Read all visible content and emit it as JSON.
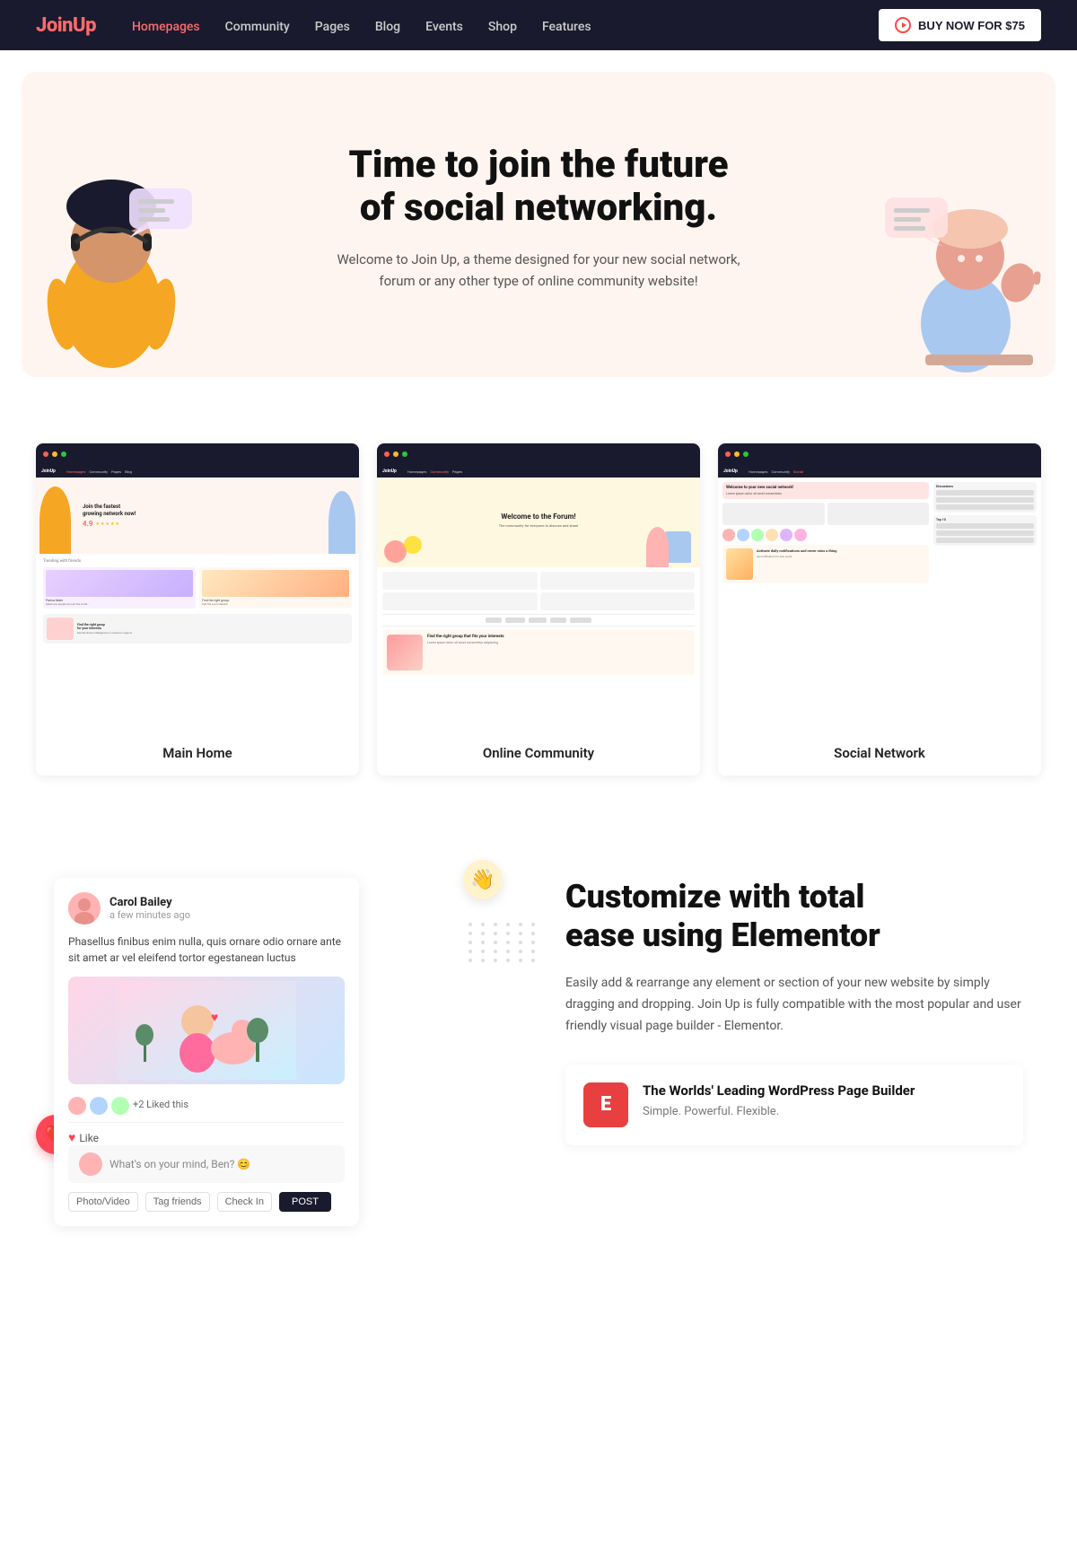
{
  "navbar": {
    "logo": "Join",
    "logo_accent": "Up",
    "nav_items": [
      {
        "label": "Homepages",
        "active": true
      },
      {
        "label": "Community",
        "active": false
      },
      {
        "label": "Pages",
        "active": false
      },
      {
        "label": "Blog",
        "active": false
      },
      {
        "label": "Events",
        "active": false
      },
      {
        "label": "Shop",
        "active": false
      },
      {
        "label": "Features",
        "active": false
      }
    ],
    "buy_button": "BUY NOW FOR $75"
  },
  "hero": {
    "heading_line1": "Time to join the future",
    "heading_line2": "of social networking.",
    "subtext": "Welcome to Join Up, a theme designed for your new social network, forum or any other type of online community website!"
  },
  "previews": [
    {
      "label": "Main Home",
      "title": "Join the fastest growing network now!",
      "stat": "4.9"
    },
    {
      "label": "Online Community",
      "title": "Welcome to the Forum!"
    },
    {
      "label": "Social Network",
      "title": "Welcome to your new social network!"
    }
  ],
  "customize": {
    "heading_line1": "Customize with total",
    "heading_line2": "ease using Elementor",
    "description": "Easily add & rearrange any element or section of your new website by simply dragging and dropping. Join Up is fully compatible with the most popular and user friendly visual page builder - Elementor.",
    "elementor_title": "The Worlds' Leading WordPress Page Builder",
    "elementor_subtitle": "Simple. Powerful. Flexible.",
    "elementor_icon": "E"
  },
  "post": {
    "user_name": "Carol Bailey",
    "user_time": "a few minutes ago",
    "post_text": "Phasellus finibus enim nulla, quis ornare odio ornare ante sit amet ar vel eleifend tortor egestanean luctus",
    "what_on_mind": "What's on your mind, Ben? 😊",
    "btn_photo": "Photo/Video",
    "btn_tag": "Tag friends",
    "btn_checkin": "Check In",
    "btn_post": "POST",
    "like_label": "Like"
  }
}
